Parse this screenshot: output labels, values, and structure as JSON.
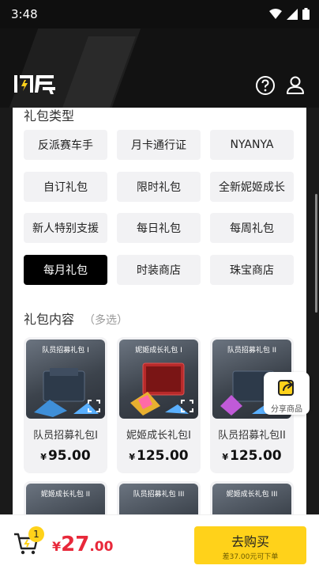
{
  "status": {
    "time": "3:48"
  },
  "header": {
    "logo_text": "闪氪"
  },
  "gift_types": {
    "title": "礼包类型",
    "items": [
      "反派赛车手",
      "月卡通行证",
      "NYANYA",
      "自订礼包",
      "限时礼包",
      "全新妮姬成长",
      "新人特别支援",
      "每日礼包",
      "每周礼包",
      "每月礼包",
      "时装商店",
      "珠宝商店"
    ],
    "active": "每月礼包"
  },
  "contents": {
    "title": "礼包内容",
    "subtitle": "（多选）",
    "cards": [
      {
        "img_title": "队员招募礼包 I",
        "name": "队员招募礼包I",
        "price_symbol": "¥",
        "price": "95.00",
        "accent": "#2b6cb0"
      },
      {
        "img_title": "妮姬成长礼包 I",
        "name": "妮姬成长礼包I",
        "price_symbol": "¥",
        "price": "125.00",
        "accent": "#c0392b"
      },
      {
        "img_title": "队员招募礼包 II",
        "name": "队员招募礼包II",
        "price_symbol": "¥",
        "price": "125.00",
        "accent": "#8e44ad"
      },
      {
        "img_title": "妮姬成长礼包 II",
        "name": "",
        "price_symbol": "",
        "price": "",
        "accent": "#c0392b"
      },
      {
        "img_title": "队员招募礼包 III",
        "name": "",
        "price_symbol": "",
        "price": "",
        "accent": "#2b6cb0"
      },
      {
        "img_title": "妮姬成长礼包 III",
        "name": "",
        "price_symbol": "",
        "price": "",
        "accent": "#8e44ad"
      }
    ]
  },
  "share": {
    "label": "分享商品"
  },
  "cart": {
    "count": "1",
    "total_symbol": "¥",
    "total_int": "27",
    "total_dec": ".00"
  },
  "buy": {
    "label": "去购买",
    "sub": "差37.00元可下单"
  },
  "colors": {
    "accent_yellow": "#ffd21a",
    "price_red": "#e8283a",
    "active_black": "#000000"
  }
}
